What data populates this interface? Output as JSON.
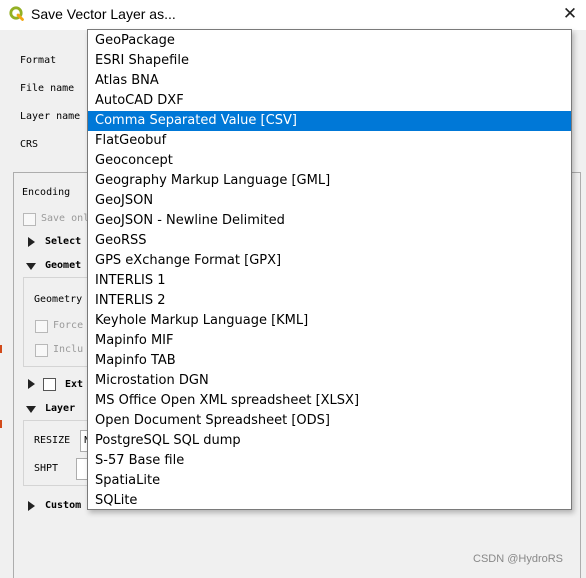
{
  "window": {
    "title": "Save Vector Layer as...",
    "close_glyph": "✕"
  },
  "form": {
    "format_label": "Format",
    "file_name_label": "File name",
    "layer_name_label": "Layer name",
    "crs_label": "CRS"
  },
  "options": {
    "encoding_label": "Encoding",
    "save_only_label": "Save onl",
    "select_label": "Select",
    "geometry_label": "Geomet",
    "geometry_type_label": "Geometry",
    "force_label": "Force",
    "include_label": "Inclu",
    "extent_label": "Ext",
    "layer_label": "Layer",
    "resize_label": "RESIZE",
    "resize_value": "N",
    "shpt_label": "SHPT",
    "custom_label": "Custom"
  },
  "dropdown": {
    "selected_index": 4,
    "items": [
      "GeoPackage",
      "ESRI Shapefile",
      "Atlas BNA",
      "AutoCAD DXF",
      "Comma Separated Value [CSV]",
      "FlatGeobuf",
      "Geoconcept",
      "Geography Markup Language [GML]",
      "GeoJSON",
      "GeoJSON - Newline Delimited",
      "GeoRSS",
      "GPS eXchange Format [GPX]",
      "INTERLIS 1",
      "INTERLIS 2",
      "Keyhole Markup Language [KML]",
      "Mapinfo MIF",
      "Mapinfo TAB",
      "Microstation DGN",
      "MS Office Open XML spreadsheet [XLSX]",
      "Open Document Spreadsheet [ODS]",
      "PostgreSQL SQL dump",
      "S-57 Base file",
      "SpatiaLite",
      "SQLite"
    ]
  },
  "watermark": "CSDN @HydroRS",
  "colors": {
    "selection": "#0078d7",
    "qgis_green": "#93b023"
  },
  "icons": {
    "app": "qgis-logo-icon",
    "close": "close-icon"
  }
}
